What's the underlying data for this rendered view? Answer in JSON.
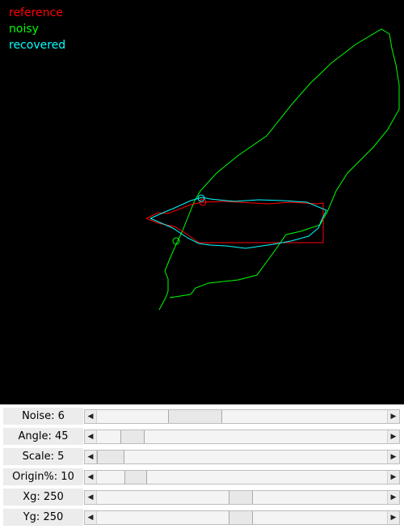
{
  "legend": {
    "reference": {
      "label": "reference",
      "color": "#ff0000"
    },
    "noisy": {
      "label": "noisy",
      "color": "#00ff00"
    },
    "recovered": {
      "label": "recovered",
      "color": "#00ffff"
    }
  },
  "sliders": [
    {
      "id": "noise",
      "label": "Noise: 6",
      "thumb_start": 0.244,
      "thumb_end": 0.432
    },
    {
      "id": "angle",
      "label": "Angle: 45",
      "thumb_start": 0.08,
      "thumb_end": 0.163
    },
    {
      "id": "scale",
      "label": "Scale: 5",
      "thumb_start": 0.0,
      "thumb_end": 0.094
    },
    {
      "id": "origin",
      "label": "Origin%: 10",
      "thumb_start": 0.094,
      "thumb_end": 0.173
    },
    {
      "id": "xg",
      "label": "Xg: 250",
      "thumb_start": 0.454,
      "thumb_end": 0.537
    },
    {
      "id": "yg",
      "label": "Yg: 250",
      "thumb_start": 0.454,
      "thumb_end": 0.537
    }
  ],
  "icons": {
    "scroll_left": "◀",
    "scroll_right": "▶"
  }
}
